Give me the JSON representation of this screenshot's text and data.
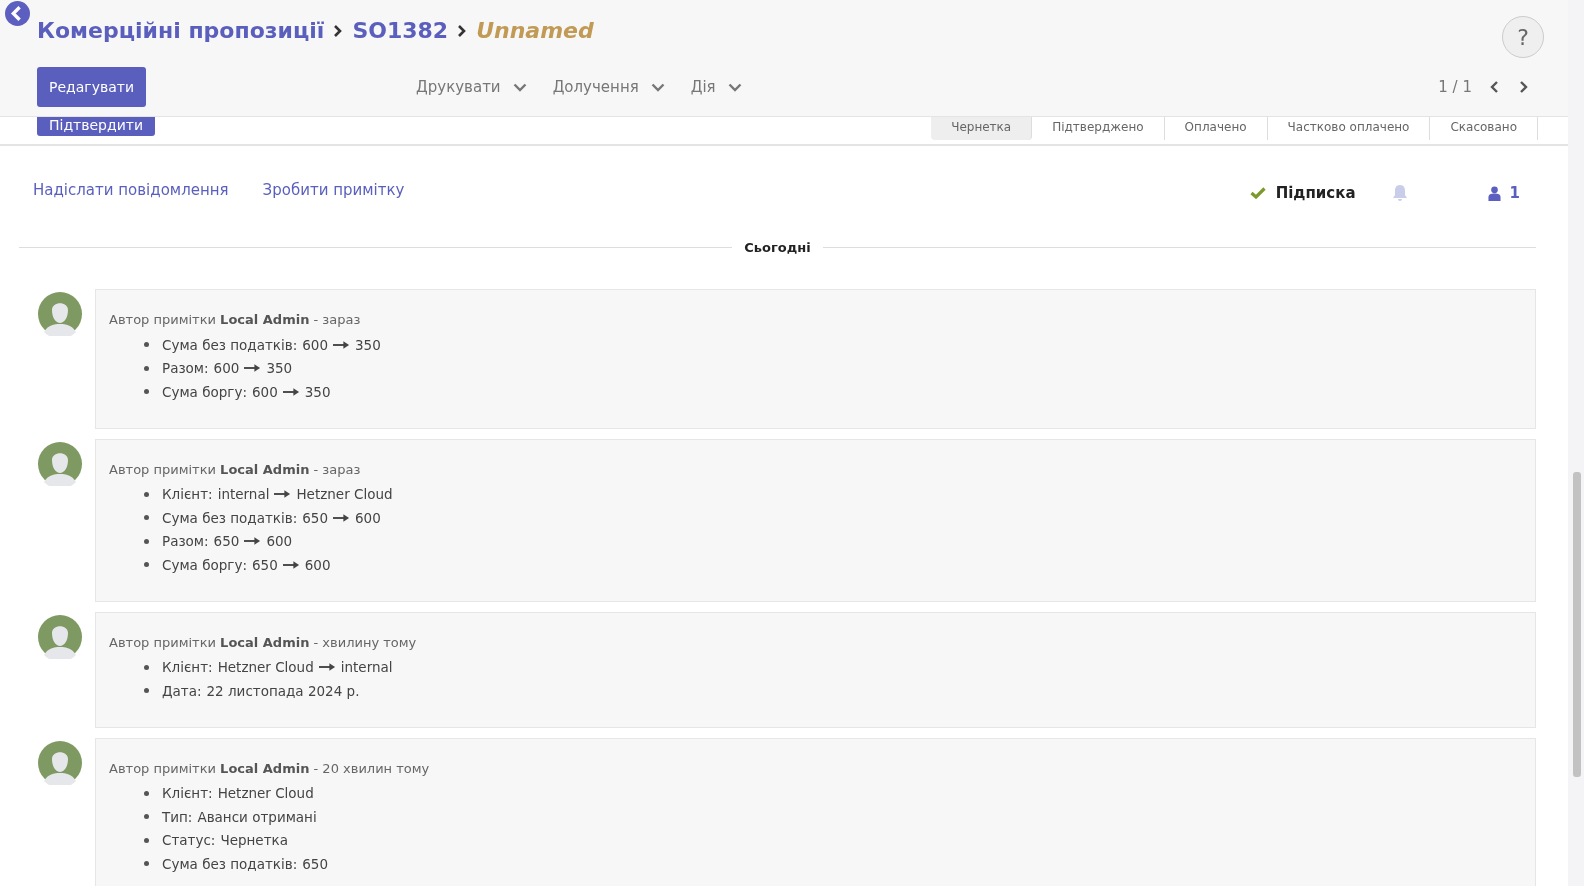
{
  "breadcrumbs": [
    {
      "label": "Комерційні пропозиції",
      "kind": "link"
    },
    {
      "label": "SO1382",
      "kind": "link"
    },
    {
      "label": "Unnamed",
      "kind": "current"
    }
  ],
  "help_button": "?",
  "edit_button": "Редагувати",
  "menus": [
    "Друкувати",
    "Долучення",
    "Дія"
  ],
  "pager": "1 / 1",
  "confirm_button": "Підтвердити",
  "statuses": [
    {
      "label": "Чернетка",
      "selected": true
    },
    {
      "label": "Підтверджено",
      "selected": false
    },
    {
      "label": "Оплачено",
      "selected": false
    },
    {
      "label": "Частково оплачено",
      "selected": false
    },
    {
      "label": "Скасовано",
      "selected": false
    }
  ],
  "chatter": {
    "send_message": "Надіслати повідомлення",
    "log_note": "Зробити примітку",
    "follow": {
      "label": "Підписка",
      "following": true
    },
    "followers_count": "1"
  },
  "date_separator": "Сьогодні",
  "messages": [
    {
      "author_prefix": "Автор примітки",
      "author": "Local Admin",
      "time": "- зараз",
      "changes": [
        {
          "label": "Сума без податків:",
          "old_value": "600",
          "new_value": "350"
        },
        {
          "label": "Разом:",
          "old_value": "600",
          "new_value": "350"
        },
        {
          "label": "Сума боргу:",
          "old_value": "600",
          "new_value": "350"
        }
      ]
    },
    {
      "author_prefix": "Автор примітки",
      "author": "Local Admin",
      "time": "- зараз",
      "changes": [
        {
          "label": "Клієнт:",
          "old_value": "internal",
          "new_value": "Hetzner Cloud"
        },
        {
          "label": "Сума без податків:",
          "old_value": "650",
          "new_value": "600"
        },
        {
          "label": "Разом:",
          "old_value": "650",
          "new_value": "600"
        },
        {
          "label": "Сума боргу:",
          "old_value": "650",
          "new_value": "600"
        }
      ]
    },
    {
      "author_prefix": "Автор примітки",
      "author": "Local Admin",
      "time": "- хвилину тому",
      "changes": [
        {
          "label": "Клієнт:",
          "old_value": "Hetzner Cloud",
          "new_value": "internal"
        },
        {
          "label": "Дата:",
          "new_value": "22 листопада 2024 р."
        }
      ]
    },
    {
      "author_prefix": "Автор примітки",
      "author": "Local Admin",
      "time": "- 20 хвилин тому",
      "changes": [
        {
          "label": "Клієнт:",
          "new_value": "Hetzner Cloud"
        },
        {
          "label": "Тип:",
          "new_value": "Аванси отримані"
        },
        {
          "label": "Статус:",
          "new_value": "Чернетка"
        },
        {
          "label": "Сума без податків:",
          "new_value": "650"
        }
      ]
    }
  ]
}
